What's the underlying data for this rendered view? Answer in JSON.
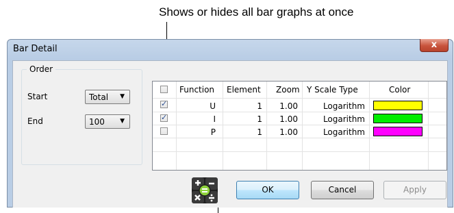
{
  "callouts": {
    "top": "Shows or hides all bar graphs at once"
  },
  "window": {
    "title": "Bar Detail",
    "close_label": "x"
  },
  "order": {
    "title": "Order",
    "start_label": "Start",
    "start_value": "Total",
    "end_label": "End",
    "end_value": "100"
  },
  "table": {
    "headers": {
      "function": "Function",
      "element": "Element",
      "zoom": "Zoom",
      "yscale": "Y Scale Type",
      "color": "Color"
    },
    "show_all_checked": false,
    "rows": [
      {
        "checked": true,
        "function": "U",
        "element": "1",
        "zoom": "1.00",
        "yscale": "Logarithm",
        "color": "#ffff00"
      },
      {
        "checked": true,
        "function": "I",
        "element": "1",
        "zoom": "1.00",
        "yscale": "Logarithm",
        "color": "#00ee00"
      },
      {
        "checked": false,
        "function": "P",
        "element": "1",
        "zoom": "1.00",
        "yscale": "Logarithm",
        "color": "#ff00ff"
      }
    ]
  },
  "buttons": {
    "ok": "OK",
    "cancel": "Cancel",
    "apply": "Apply"
  },
  "icons": {
    "calculator": "calculator-icon",
    "close": "close-icon",
    "dropdown": "chevron-down-icon",
    "check": "checkmark-icon"
  },
  "colors": {
    "title_bg": "#b9cde5",
    "client_bg": "#f0f0f0",
    "ok_accent": "#3c7fb1"
  }
}
